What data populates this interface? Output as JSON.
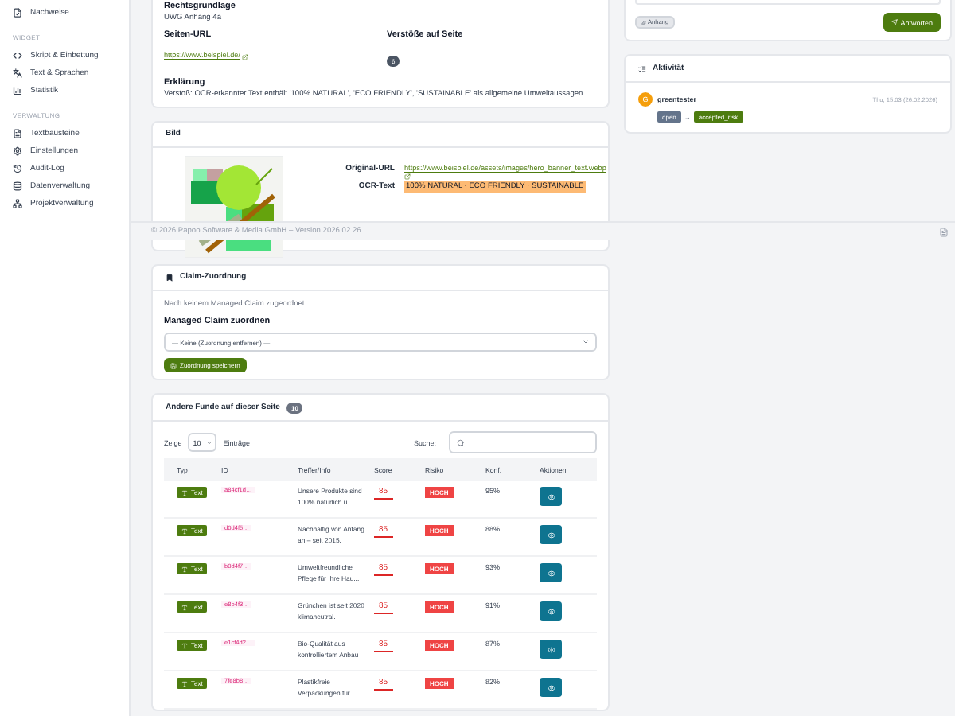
{
  "sidebar": {
    "items": [
      {
        "label": "Nachweise"
      }
    ],
    "sections": [
      {
        "title": "WIDGET",
        "items": [
          {
            "label": "Skript & Einbettung"
          },
          {
            "label": "Text & Sprachen"
          },
          {
            "label": "Statistik"
          }
        ]
      },
      {
        "title": "VERWALTUNG",
        "items": [
          {
            "label": "Textbausteine"
          },
          {
            "label": "Einstellungen"
          },
          {
            "label": "Audit-Log"
          },
          {
            "label": "Datenverwaltung"
          },
          {
            "label": "Projektverwaltung"
          }
        ]
      }
    ]
  },
  "details": {
    "legal_label": "Rechtsgrundlage",
    "legal_value": "UWG Anhang 4a",
    "url_label": "Seiten-URL",
    "url": "https://www.beispiel.de/",
    "violations_label": "Verstöße auf Seite",
    "violations_count": "6",
    "explanation_label": "Erklärung",
    "explanation": "Verstoß: OCR-erkannter Text enthält '100% NATURAL', 'ECO FRIENDLY', 'SUSTAINABLE' als allgemeine Umweltaussagen."
  },
  "image_card": {
    "title": "Bild",
    "original_url_label": "Original-URL",
    "original_url": "https://www.beispiel.de/assets/images/hero_banner_text.webp",
    "ocr_label": "OCR-Text",
    "ocr_text": "100% NATURAL · ECO FRIENDLY · SUSTAINABLE"
  },
  "footer": {
    "text": "© 2026 Papoo Software & Media GmbH – Version 2026.02.26"
  },
  "claim_card": {
    "title": "Claim-Zuordnung",
    "note": "Nach keinem Managed Claim zugeordnet.",
    "select_label": "Managed Claim zuordnen",
    "select_value": "— Keine (Zuordnung entfernen) —",
    "save_button": "Zuordnung speichern"
  },
  "findings": {
    "title": "Andere Funde auf dieser Seite",
    "count": "10",
    "show_label": "Zeige",
    "page_size": "10",
    "entries_label": "Einträge",
    "search_label": "Suche:",
    "columns": [
      "Typ",
      "ID",
      "Treffer/Info",
      "Score",
      "Risiko",
      "Konf.",
      "Aktionen"
    ],
    "rows": [
      {
        "type": "Text",
        "id": "a84cf1d…",
        "info": "Unsere Produkte sind 100% natürlich u...",
        "score": "85",
        "risk": "HOCH",
        "conf": "95%"
      },
      {
        "type": "Text",
        "id": "d0d4f5…",
        "info": "Nachhaltig von Anfang an – seit 2015.",
        "score": "85",
        "risk": "HOCH",
        "conf": "88%"
      },
      {
        "type": "Text",
        "id": "b0d4f7…",
        "info": "Umweltfreundliche Pflege für Ihre Hau...",
        "score": "85",
        "risk": "HOCH",
        "conf": "93%"
      },
      {
        "type": "Text",
        "id": "e8b4f3…",
        "info": "Grünchen ist seit 2020 klimaneutral.",
        "score": "85",
        "risk": "HOCH",
        "conf": "91%"
      },
      {
        "type": "Text",
        "id": "e1cf4d2…",
        "info": "Bio-Qualität aus kontrolliertem Anbau",
        "score": "85",
        "risk": "HOCH",
        "conf": "87%"
      },
      {
        "type": "Text",
        "id": "7fe8b8…",
        "info": "Plastikfreie Verpackungen für",
        "score": "85",
        "risk": "HOCH",
        "conf": "82%"
      }
    ]
  },
  "reply": {
    "attach_button": "Anhang",
    "reply_button": "Antworten"
  },
  "activity": {
    "title": "Aktivität",
    "entries": [
      {
        "avatar": "G",
        "user": "greentester",
        "time": "Thu, 15:03 (26.02.2026)",
        "from_status": "open",
        "arrow": "→",
        "to_status": "accepted_risk"
      }
    ]
  }
}
